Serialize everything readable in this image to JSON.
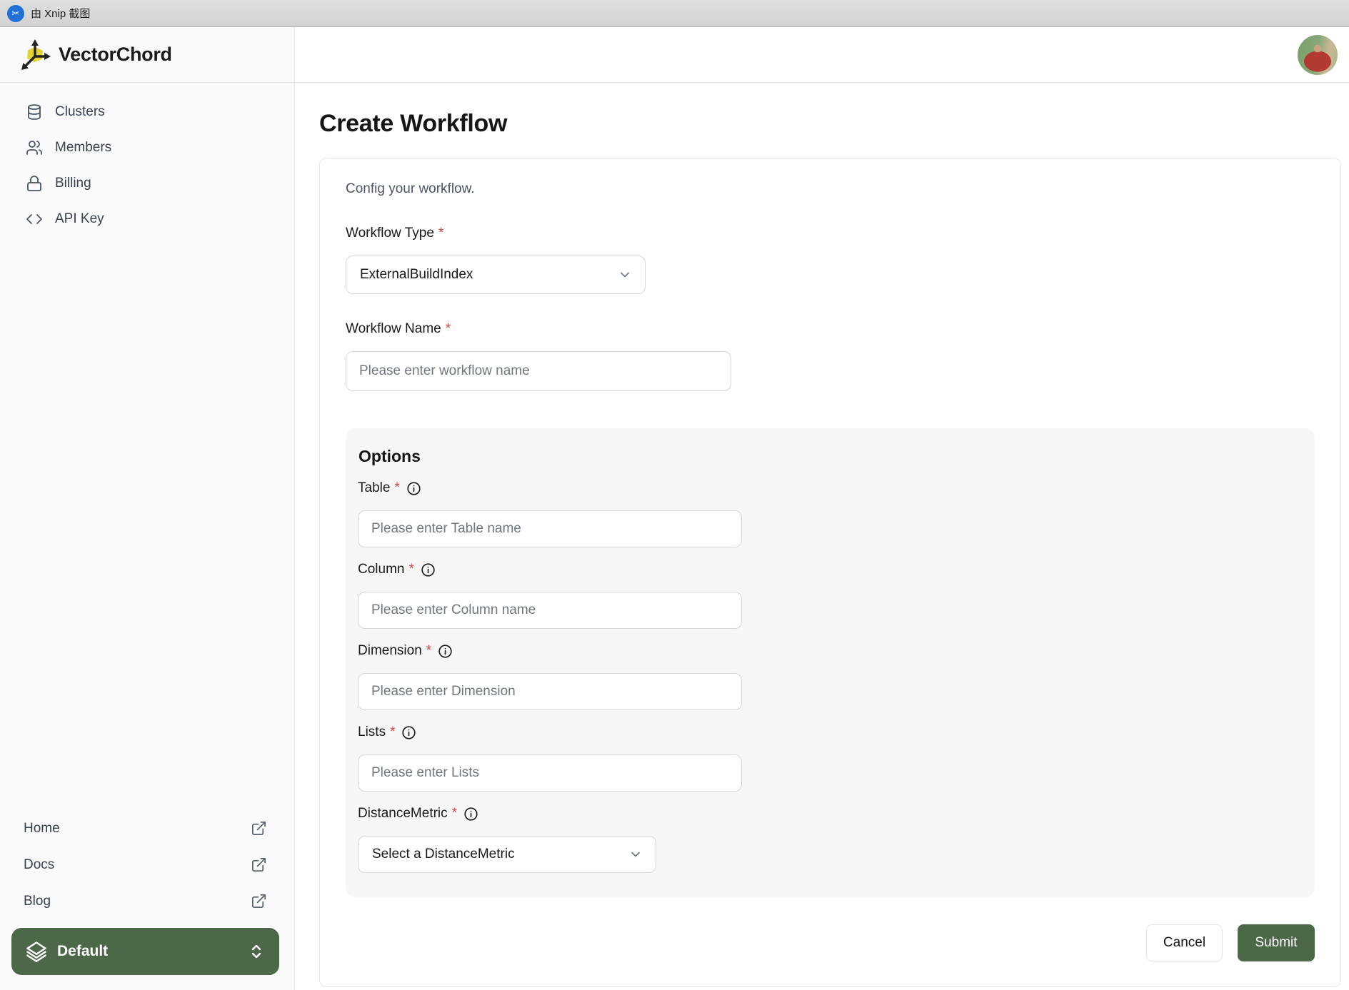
{
  "titlebar": {
    "text": "由 Xnip 截图",
    "icon": "xnip-scissors-icon"
  },
  "marks": {
    "required": "*"
  },
  "sidebar": {
    "brand": "VectorChord",
    "nav": [
      {
        "icon": "database-icon",
        "label": "Clusters"
      },
      {
        "icon": "users-icon",
        "label": "Members"
      },
      {
        "icon": "lock-icon",
        "label": "Billing"
      },
      {
        "icon": "code-icon",
        "label": "API Key"
      }
    ],
    "links": [
      {
        "label": "Home",
        "icon": "external-link-icon"
      },
      {
        "label": "Docs",
        "icon": "external-link-icon"
      },
      {
        "label": "Blog",
        "icon": "external-link-icon"
      }
    ],
    "workspace": {
      "icon": "layers-icon",
      "label": "Default",
      "chevron": "chevrons-up-down-icon"
    }
  },
  "main": {
    "title": "Create Workflow",
    "card": {
      "intro": "Config your workflow.",
      "workflow_type": {
        "label": "Workflow Type",
        "value": "ExternalBuildIndex"
      },
      "workflow_name": {
        "label": "Workflow Name",
        "placeholder": "Please enter workflow name"
      },
      "options": {
        "title": "Options",
        "fields": [
          {
            "label": "Table",
            "control": "input",
            "placeholder": "Please enter Table name"
          },
          {
            "label": "Column",
            "control": "input",
            "placeholder": "Please enter Column name"
          },
          {
            "label": "Dimension",
            "control": "input",
            "placeholder": "Please enter Dimension"
          },
          {
            "label": "Lists",
            "control": "input",
            "placeholder": "Please enter Lists"
          },
          {
            "label": "DistanceMetric",
            "control": "select",
            "placeholder": "Select a DistanceMetric"
          }
        ]
      },
      "actions": {
        "cancel": "Cancel",
        "submit": "Submit"
      }
    }
  },
  "colors": {
    "accent_green": "#4d6849",
    "required_red": "#e0413f"
  }
}
